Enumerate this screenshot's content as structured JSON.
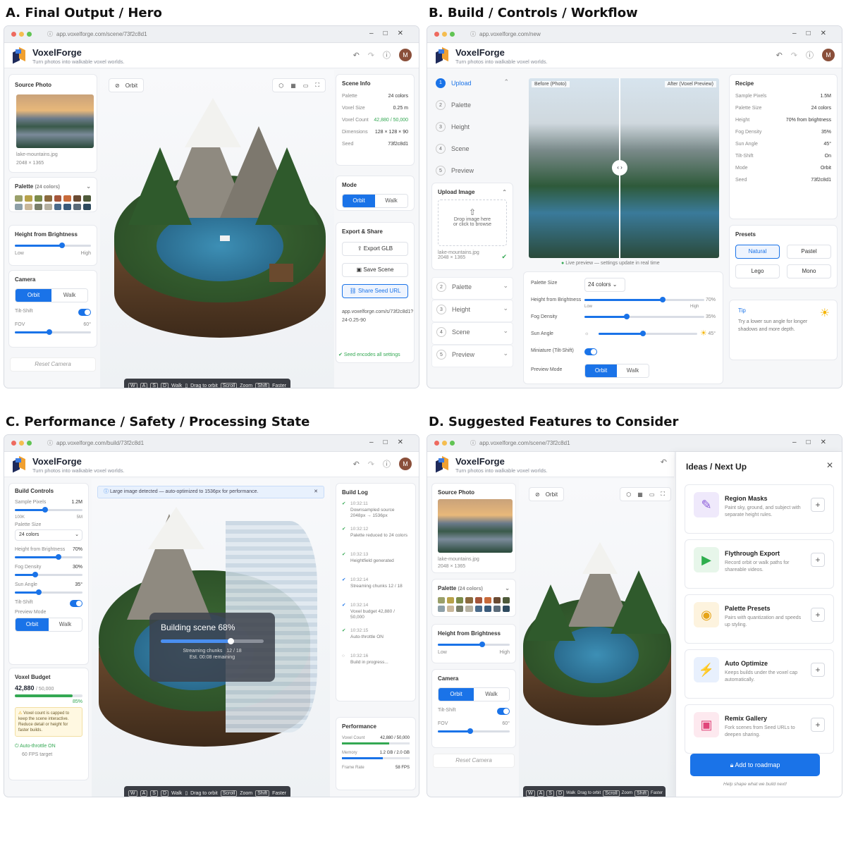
{
  "panels": {
    "a": {
      "title": "A. Final Output / Hero",
      "url": "app.voxelforge.com/scene/73f2c8d1"
    },
    "b": {
      "title": "B. Build / Controls / Workflow",
      "url": "app.voxelforge.com/new"
    },
    "c": {
      "title": "C. Performance / Safety / Processing State",
      "url": "app.voxelforge.com/build/73f2c8d1"
    },
    "d": {
      "title": "D. Suggested Features to Consider",
      "url": "app.voxelforge.com/scene/73f2c8d1"
    }
  },
  "app": {
    "name": "VoxelForge",
    "tagline": "Turn photos into walkable voxel worlds.",
    "avatar": "M"
  },
  "common": {
    "source_photo": "Source Photo",
    "file_name": "lake-mountains.jpg",
    "file_dims": "2048 × 1365",
    "palette_label": "Palette",
    "palette_count": "(24 colors)",
    "height_label": "Height from Brightness",
    "low": "Low",
    "high": "High",
    "camera": "Camera",
    "orbit": "Orbit",
    "walk": "Walk",
    "tilt_shift": "Tilt-Shift",
    "fov": "FOV",
    "fov_value": "60°",
    "reset_camera": "Reset Camera",
    "hint": {
      "w": "W",
      "a": "A",
      "s": "S",
      "d": "D",
      "walk": "Walk",
      "drag": "Drag to orbit",
      "scroll": "Scroll",
      "zoom": "Zoom",
      "shift": "Shift",
      "faster": "Faster"
    },
    "swatches": [
      "#9aa06a",
      "#b8a24a",
      "#7c8b4a",
      "#8a6a3e",
      "#a5553a",
      "#c86a3a",
      "#6a4a32",
      "#4e5a3a",
      "#8ea0a8",
      "#c9b79a",
      "#7a7f6a",
      "#b5b0a0",
      "#4a6a8a",
      "#3a5a7a",
      "#5a6a78",
      "#2e4a5e"
    ]
  },
  "a": {
    "scene_info": "Scene Info",
    "rows": [
      {
        "k": "Palette",
        "v": "24 colors"
      },
      {
        "k": "Voxel Size",
        "v": "0.25 m"
      },
      {
        "k": "Voxel Count",
        "v": "42,880 / 50,000"
      },
      {
        "k": "Dimensions",
        "v": "128 × 128 × 90"
      },
      {
        "k": "Seed",
        "v": "73f2c8d1"
      }
    ],
    "mode": "Mode",
    "export": "Export & Share",
    "export_glb": "Export GLB",
    "save_scene": "Save Scene",
    "share_seed": "Share Seed URL",
    "seed_url": "app.voxelforge.com/s/73f2c8d1?24-0.25-90",
    "seed_note": "Seed encodes all settings"
  },
  "b": {
    "steps": [
      {
        "n": "1",
        "label": "Upload"
      },
      {
        "n": "2",
        "label": "Palette"
      },
      {
        "n": "3",
        "label": "Height"
      },
      {
        "n": "4",
        "label": "Scene"
      },
      {
        "n": "5",
        "label": "Preview"
      }
    ],
    "upload_image": "Upload Image",
    "drop1": "Drop image here",
    "drop2": "or click to browse",
    "before": "Before (Photo)",
    "after": "After (Voxel Preview)",
    "live": "Live preview — settings update in real time",
    "palette_size": "Palette Size",
    "palette_sel": "24 colors",
    "height_brightness": "Height from Brightness",
    "h_val": "70%",
    "fog": "Fog Density",
    "fog_val": "35%",
    "sun": "Sun Angle",
    "sun_val": "45°",
    "miniature": "Miniature (Tilt-Shift)",
    "preview_mode": "Preview Mode",
    "recipe": "Recipe",
    "recipe_rows": [
      {
        "k": "Sample Pixels",
        "v": "1.5M"
      },
      {
        "k": "Palette Size",
        "v": "24 colors"
      },
      {
        "k": "Height",
        "v": "70% from brightness"
      },
      {
        "k": "Fog Density",
        "v": "35%"
      },
      {
        "k": "Sun Angle",
        "v": "45°"
      },
      {
        "k": "Tilt-Shift",
        "v": "On"
      },
      {
        "k": "Mode",
        "v": "Orbit"
      },
      {
        "k": "Seed",
        "v": "73f2c8d1"
      }
    ],
    "presets": "Presets",
    "presets_list": [
      "Natural",
      "Pastel",
      "Lego",
      "Mono"
    ],
    "tip_title": "Tip",
    "tip_text": "Try a lower sun angle for longer shadows and more depth."
  },
  "c": {
    "build_controls": "Build Controls",
    "sample_pixels": "Sample Pixels",
    "sp_val": "1.2M",
    "sp_min": "100K",
    "sp_max": "5M",
    "palette_size": "Palette Size",
    "palette_sel": "24 colors",
    "height_val": "70%",
    "fog": "Fog Density",
    "fog_val": "30%",
    "sun": "Sun Angle",
    "sun_val": "35°",
    "preview_mode": "Preview Mode",
    "budget": "Voxel Budget",
    "budget_val": "42,880",
    "budget_max": "/ 50,000",
    "budget_pct": "85%",
    "budget_fill": 0.85,
    "warning": "Voxel count is capped to keep the scene interactive. Reduce detail or height for faster builds.",
    "auto": "Auto-throttle ON",
    "fps": "60 FPS target",
    "banner": "Large image detected — auto-optimized to 1536px for performance.",
    "building": "Building scene 68%",
    "progress": 0.68,
    "chunks": "Streaming chunks",
    "chunks_val": "12 / 18",
    "est": "Est. 00:08 remaining",
    "build_log": "Build Log",
    "log": [
      {
        "t": "10:32:11",
        "m": "Downsampled source 2048px → 1536px"
      },
      {
        "t": "10:32:12",
        "m": "Palette reduced to 24 colors"
      },
      {
        "t": "10:32:13",
        "m": "Heightfield generated"
      },
      {
        "t": "10:32:14",
        "m": "Streaming chunks 12 / 18"
      },
      {
        "t": "10:32:14",
        "m": "Voxel budget 42,880 / 50,000"
      },
      {
        "t": "10:32:15",
        "m": "Auto-throttle ON"
      },
      {
        "t": "10:32:16",
        "m": "Build in progress..."
      }
    ],
    "performance": "Performance",
    "voxel_count": "Voxel Count",
    "vc_val": "42,880 / 50,000",
    "memory": "Memory",
    "mem_val": "1.2 GB / 2.0 GB",
    "frame_rate": "Frame Rate",
    "fr_val": "58 FPS"
  },
  "d": {
    "ideas": "Ideas / Next Up",
    "items": [
      {
        "title": "Region Masks",
        "desc": "Paint sky, ground, and subject with separate height rules.",
        "icon": "✎",
        "bg": "#efe9fb",
        "fg": "#8a5ad8"
      },
      {
        "title": "Flythrough Export",
        "desc": "Record orbit or walk paths for shareable videos.",
        "icon": "▶",
        "bg": "#e7f6ea",
        "fg": "#2fae4e"
      },
      {
        "title": "Palette Presets",
        "desc": "Pairs with quantization and speeds up styling.",
        "icon": "◉",
        "bg": "#fdf3de",
        "fg": "#e6a419"
      },
      {
        "title": "Auto Optimize",
        "desc": "Keeps builds under the voxel cap automatically.",
        "icon": "⚡",
        "bg": "#e8f0fd",
        "fg": "#1a73e8"
      },
      {
        "title": "Remix Gallery",
        "desc": "Fork scenes from Seed URLs to deepen sharing.",
        "icon": "▣",
        "bg": "#fde9ef",
        "fg": "#e0467a"
      }
    ],
    "add": "Add to roadmap",
    "help": "Help shape what we build next!"
  }
}
